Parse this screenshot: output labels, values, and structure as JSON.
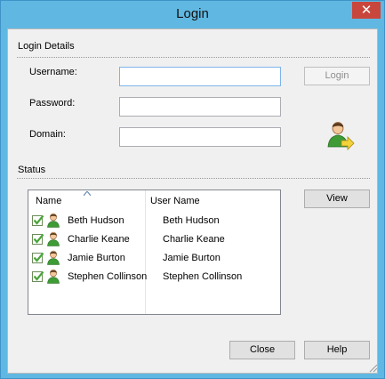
{
  "window": {
    "title": "Login",
    "close_glyph": "✕"
  },
  "login_details": {
    "section_label": "Login Details",
    "username_label": "Username:",
    "password_label": "Password:",
    "domain_label": "Domain:",
    "username_value": "",
    "password_value": "",
    "domain_value": "",
    "login_button": "Login",
    "login_button_enabled": false,
    "user_icon": "user-login-icon"
  },
  "status": {
    "section_label": "Status",
    "columns": [
      "Name",
      "User Name"
    ],
    "sorted_column": "Name",
    "rows": [
      {
        "name": "Beth Hudson",
        "user_name": "Beth Hudson",
        "checked": true
      },
      {
        "name": "Charlie Keane",
        "user_name": "Charlie Keane",
        "checked": true
      },
      {
        "name": "Jamie Burton",
        "user_name": "Jamie Burton",
        "checked": true
      },
      {
        "name": "Stephen Collinson",
        "user_name": "Stephen Collinson",
        "checked": true
      }
    ],
    "view_button": "View"
  },
  "footer": {
    "close_button": "Close",
    "help_button": "Help"
  },
  "colors": {
    "titlebar": "#60b8e2",
    "close_button": "#c9463d",
    "check": "#4aa53a",
    "user_icon": "#3e9b35"
  }
}
